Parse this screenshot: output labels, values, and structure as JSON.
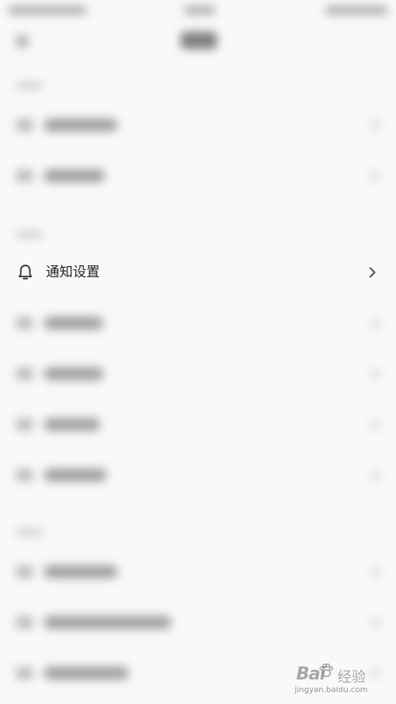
{
  "notification_row": {
    "label": "通知设置",
    "icon": "bell-icon",
    "chevron": "chevron-right-icon"
  },
  "watermark": {
    "url": "jingyan.baidu.com"
  },
  "colors": {
    "background": "#f9f9f9",
    "text": "#222222",
    "icon": "#333333",
    "chevron": "#555555"
  }
}
